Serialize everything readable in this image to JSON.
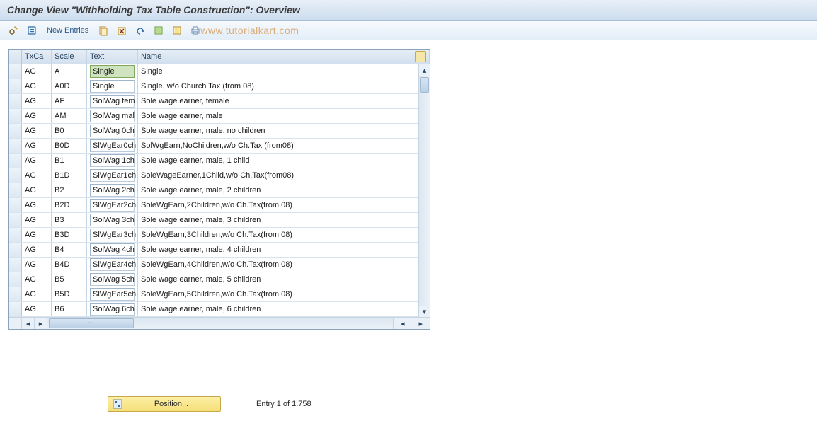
{
  "page_title": "Change View \"Withholding Tax Table Construction\": Overview",
  "toolbar": {
    "new_entries_label": "New Entries"
  },
  "watermark": "www.tutorialkart.com",
  "table": {
    "headers": {
      "txca": "TxCa",
      "scale": "Scale",
      "text": "Text",
      "name": "Name"
    },
    "rows": [
      {
        "txca": "AG",
        "scale": "A",
        "text": "Single",
        "name": "Single",
        "selected": true
      },
      {
        "txca": "AG",
        "scale": "A0D",
        "text": "Single",
        "name": "Single, w/o Church Tax (from 08)"
      },
      {
        "txca": "AG",
        "scale": "AF",
        "text": "SolWag fem",
        "name": "Sole wage earner, female"
      },
      {
        "txca": "AG",
        "scale": "AM",
        "text": "SolWag mal",
        "name": "Sole wage earner, male"
      },
      {
        "txca": "AG",
        "scale": "B0",
        "text": "SolWag 0ch",
        "name": "Sole wage earner, male, no children"
      },
      {
        "txca": "AG",
        "scale": "B0D",
        "text": "SlWgEar0ch",
        "name": "SolWgEarn,NoChildren,w/o Ch.Tax (from08)"
      },
      {
        "txca": "AG",
        "scale": "B1",
        "text": "SolWag 1ch",
        "name": "Sole wage earner, male, 1 child"
      },
      {
        "txca": "AG",
        "scale": "B1D",
        "text": "SlWgEar1ch",
        "name": "SoleWageEarner,1Child,w/o Ch.Tax(from08)"
      },
      {
        "txca": "AG",
        "scale": "B2",
        "text": "SolWag 2ch",
        "name": "Sole wage earner, male, 2 children"
      },
      {
        "txca": "AG",
        "scale": "B2D",
        "text": "SlWgEar2ch",
        "name": "SoleWgEarn,2Children,w/o Ch.Tax(from 08)"
      },
      {
        "txca": "AG",
        "scale": "B3",
        "text": "SolWag 3ch",
        "name": "Sole wage earner, male, 3 children"
      },
      {
        "txca": "AG",
        "scale": "B3D",
        "text": "SlWgEar3ch",
        "name": "SoleWgEarn,3Children,w/o Ch.Tax(from 08)"
      },
      {
        "txca": "AG",
        "scale": "B4",
        "text": "SolWag 4ch",
        "name": "Sole wage earner, male, 4 children"
      },
      {
        "txca": "AG",
        "scale": "B4D",
        "text": "SlWgEar4ch",
        "name": "SoleWgEarn,4Children,w/o Ch.Tax(from 08)"
      },
      {
        "txca": "AG",
        "scale": "B5",
        "text": "SolWag 5ch",
        "name": "Sole wage earner, male, 5 children"
      },
      {
        "txca": "AG",
        "scale": "B5D",
        "text": "SlWgEar5ch",
        "name": "SoleWgEarn,5Children,w/o Ch.Tax(from 08)"
      },
      {
        "txca": "AG",
        "scale": "B6",
        "text": "SolWag 6ch",
        "name": "Sole wage earner, male, 6 children"
      }
    ]
  },
  "position_button_label": "Position...",
  "entry_info": "Entry 1 of 1.758",
  "colors": {
    "header_bg": "#d6e3f0",
    "selection_bg": "#cfe3bf",
    "gold_btn": "#f6e48d"
  }
}
